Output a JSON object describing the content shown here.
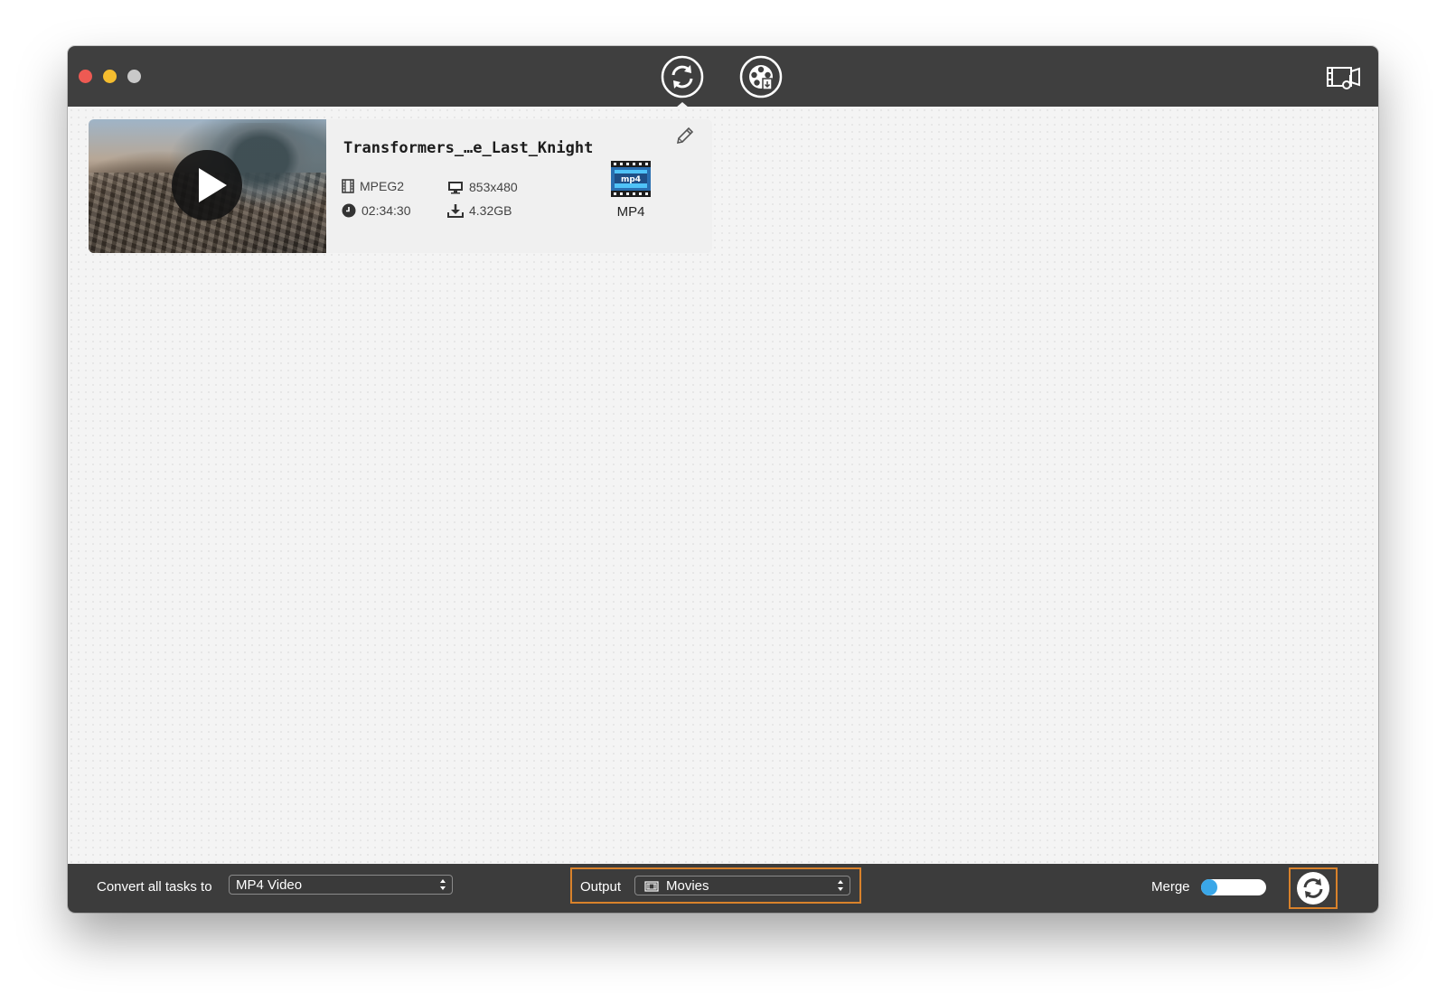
{
  "titlebar": {
    "tabs": [
      {
        "name": "convert",
        "icon": "convert-icon"
      },
      {
        "name": "media",
        "icon": "media-reel-icon"
      }
    ],
    "right_icon": "screen-recorder-icon"
  },
  "task": {
    "filename": "Transformers_…e_Last_Knight",
    "codec": "MPEG2",
    "resolution": "853x480",
    "duration": "02:34:30",
    "size": "4.32GB",
    "target_format": "MP4"
  },
  "bottom": {
    "convert_label": "Convert all tasks to",
    "convert_value": "MP4 Video",
    "output_label": "Output",
    "output_value": "Movies",
    "merge_label": "Merge",
    "merge_enabled": false
  },
  "colors": {
    "accent": "#d9822b",
    "toggle": "#3aa7e8",
    "titlebar": "#3f3f3f"
  }
}
